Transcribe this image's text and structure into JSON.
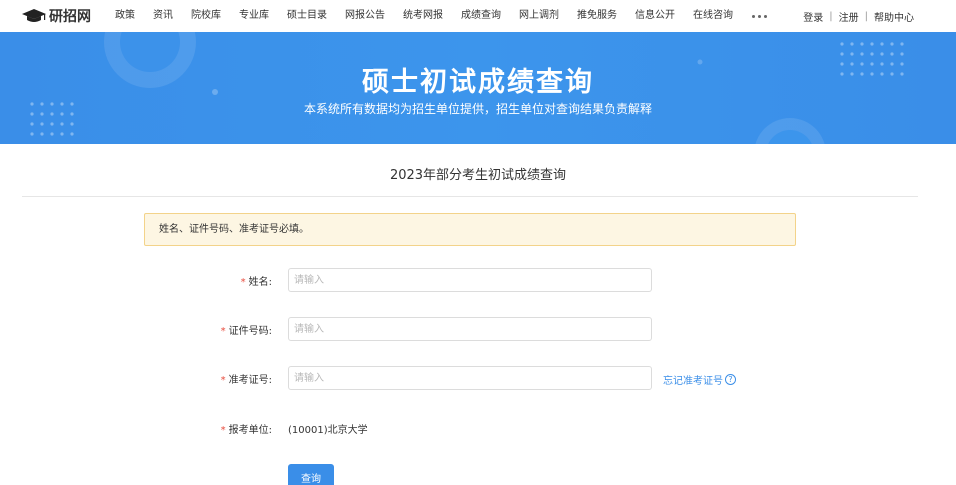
{
  "site": {
    "logo_text": "研招网"
  },
  "nav": {
    "items": [
      "政策",
      "资讯",
      "院校库",
      "专业库",
      "硕士目录",
      "网报公告",
      "统考网报",
      "成绩查询",
      "网上调剂",
      "推免服务",
      "信息公开",
      "在线咨询"
    ],
    "more_icon": "ellipsis-icon",
    "login": "登录",
    "register": "注册",
    "help": "帮助中心",
    "separator": "|"
  },
  "banner": {
    "title": "硕士初试成绩查询",
    "subtitle": "本系统所有数据均为招生单位提供，招生单位对查询结果负责解释"
  },
  "form": {
    "heading": "2023年部分考生初试成绩查询",
    "notice": "姓名、证件号码、准考证号必填。",
    "required_mark": "*",
    "fields": {
      "name": {
        "label": "姓名:",
        "placeholder": "请输入"
      },
      "id_number": {
        "label": "证件号码:",
        "placeholder": "请输入"
      },
      "exam_number": {
        "label": "准考证号:",
        "placeholder": "请输入"
      },
      "school": {
        "label": "报考单位:",
        "value": "(10001)北京大学"
      }
    },
    "forgot_link": "忘记准考证号",
    "forgot_icon": "?",
    "submit_label": "查询"
  },
  "colors": {
    "primary": "#3a8ee8",
    "required": "#e84c3d",
    "notice_bg": "#fdf6e3",
    "notice_border": "#f3d38a"
  }
}
